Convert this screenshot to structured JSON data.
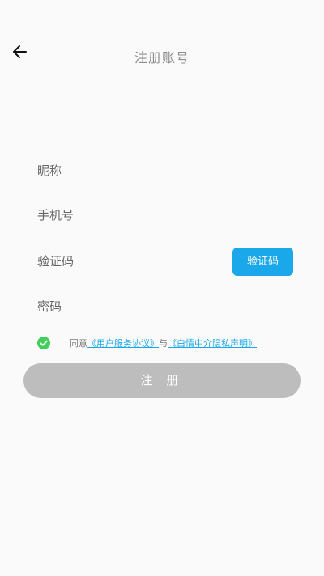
{
  "header": {
    "title": "注册账号",
    "back_icon": "arrow-left-icon"
  },
  "form": {
    "nickname_label": "昵称",
    "phone_label": "手机号",
    "code_label": "验证码",
    "password_label": "密码",
    "code_button": "验证码"
  },
  "agreement": {
    "checked": true,
    "prefix": "同意",
    "user_agreement": "《用户服务协议》",
    "connector": "与",
    "privacy_policy": "《白情中介隐私声明》"
  },
  "register_button": "注 册",
  "colors": {
    "accent": "#1aa8ea",
    "check": "#3fcf5a",
    "button_disabled": "#bdbdbd"
  }
}
